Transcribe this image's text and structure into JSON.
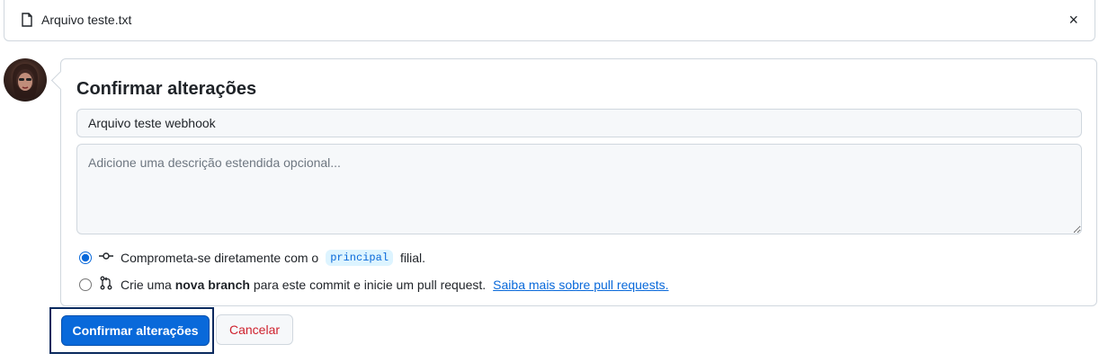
{
  "file_bar": {
    "file_icon": "file-icon",
    "file_name": "Arquivo teste.txt",
    "close_icon": "close-icon",
    "close_glyph": "×"
  },
  "commit_form": {
    "title": "Confirmar alterações",
    "summary_value": "Arquivo teste webhook",
    "description_placeholder": "Adicione uma descrição estendida opcional...",
    "option_direct": {
      "selected": true,
      "text_before": "Comprometa-se diretamente com o",
      "branch": "principal",
      "text_after": "filial."
    },
    "option_new_branch": {
      "selected": false,
      "text_before": "Crie uma",
      "bold": "nova branch",
      "text_after": "para este commit e inicie um pull request.",
      "link": "Saiba mais sobre pull requests."
    }
  },
  "actions": {
    "commit_label": "Confirmar alterações",
    "cancel_label": "Cancelar"
  },
  "colors": {
    "primary": "#0969da",
    "danger": "#cf222e",
    "border": "#d0d7de"
  }
}
